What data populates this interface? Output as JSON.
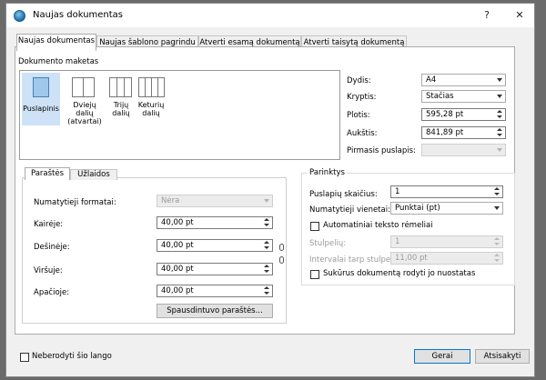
{
  "window": {
    "title": "Naujas dokumentas",
    "help": "?",
    "close": "✕"
  },
  "tabs": [
    {
      "label": "Naujas dokumentas"
    },
    {
      "label": "Naujas šablono pagrindu"
    },
    {
      "label": "Atverti esamą dokumentą"
    },
    {
      "label": "Atverti taisytą dokumentą"
    }
  ],
  "maket": {
    "title": "Dokumento maketas",
    "options": [
      {
        "label": "Puslapinis"
      },
      {
        "label": "Dviejų dalių (atvartai)"
      },
      {
        "label": "Trijų dalių"
      },
      {
        "label": "Keturių dalių"
      }
    ],
    "selected": "Puslapinis"
  },
  "page": {
    "size_label": "Dydis:",
    "size_value": "A4",
    "orientation_label": "Kryptis:",
    "orientation_value": "Stačias",
    "width_label": "Plotis:",
    "width_value": "595,28 pt",
    "height_label": "Aukštis:",
    "height_value": "841,89 pt",
    "first_page_label": "Pirmasis puslapis:",
    "first_page_value": ""
  },
  "margins": {
    "tabs": [
      {
        "label": "Paraštės"
      },
      {
        "label": "Užlaidos"
      }
    ],
    "preset_label": "Numatytieji formatai:",
    "preset_value": "Nėra",
    "left_label": "Kairėje:",
    "left_value": "40,00 pt",
    "right_label": "Dešinėje:",
    "right_value": "40,00 pt",
    "top_label": "Viršuje:",
    "top_value": "40,00 pt",
    "bottom_label": "Apačioje:",
    "bottom_value": "40,00 pt",
    "printer_button": "Spausdintuvo paraštės..."
  },
  "options": {
    "title": "Parinktys",
    "pages_label": "Puslapių skaičius:",
    "pages_value": "1",
    "unit_label": "Numatytieji vienetai:",
    "unit_value": "Punktai (pt)",
    "auto_frames_label": "Automatiniai teksto rėmeliai",
    "columns_label": "Stulpelių:",
    "columns_value": "1",
    "gap_label": "Intervalai tarp stulpelių:",
    "gap_value": "11,00 pt",
    "show_settings_label": "Sukūrus dokumentą rodyti jo nuostatas"
  },
  "footer": {
    "dont_show_label": "Neberodyti šio lango",
    "ok_button": "Gerai",
    "cancel_button": "Atsisakyti"
  }
}
